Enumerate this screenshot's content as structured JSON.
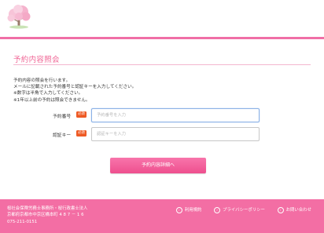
{
  "header": {
    "logo_icon": "cherry-blossom-tree-icon"
  },
  "page": {
    "title": "予約内容照会",
    "intro": [
      "予約内容の照会を行います。",
      "メールに記載された予約番号と認証キーを入力してください。",
      "※数字は半角で入力してください。",
      "※1年以上前の予約は照会できません。"
    ]
  },
  "form": {
    "required_badge": "必須",
    "reservation_number": {
      "label": "予約番号",
      "placeholder": "予約番号を入力"
    },
    "auth_key": {
      "label": "認証キー",
      "placeholder": "認証キーを入力"
    },
    "submit_label": "予約内容詳細へ"
  },
  "footer": {
    "org": "桜社会保険労務士事務所・桜行政書士法人",
    "address": "京都府京都市中京区橋本町 4 8 7 － 1 6",
    "phone": "075-211-0151",
    "links": [
      {
        "label": "利用規約",
        "icon": "chevron-right-icon"
      },
      {
        "label": "プライバシーポリシー",
        "icon": "chevron-right-icon"
      },
      {
        "label": "お問い合わせ",
        "icon": "chevron-right-icon"
      }
    ]
  },
  "colors": {
    "accent": "#f36ea4",
    "required": "#ee5a24"
  }
}
